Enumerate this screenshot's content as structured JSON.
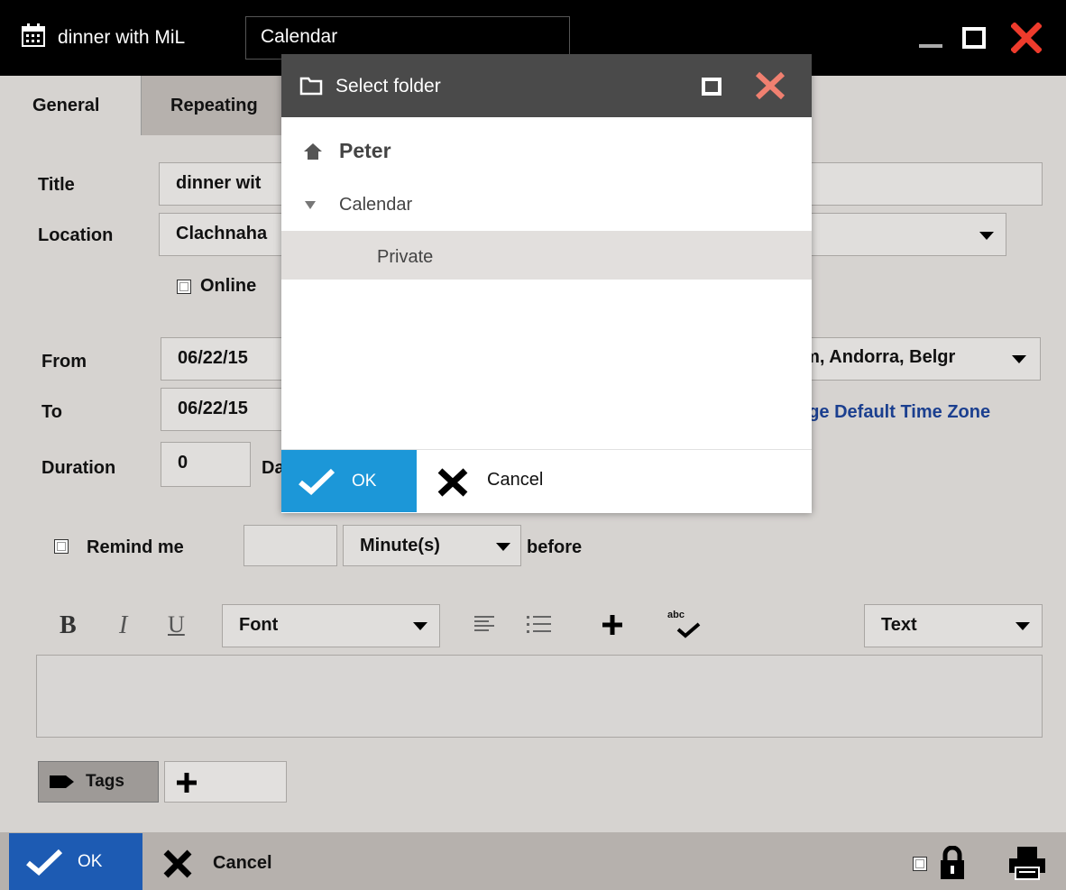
{
  "window": {
    "title": "dinner with MiL",
    "calendar_field": "Calendar"
  },
  "tabs": [
    {
      "label": "General"
    },
    {
      "label": "Repeating"
    }
  ],
  "form": {
    "title_label": "Title",
    "title_value": "dinner wit",
    "location_label": "Location",
    "location_value": "Clachnaha",
    "online_label": "Online",
    "from_label": "From",
    "from_date": "06/22/15",
    "timezone_value": "am, Andorra, Belgr",
    "to_label": "To",
    "to_date": "06/22/15",
    "change_timezone_link": "nge Default Time Zone",
    "duration_label": "Duration",
    "duration_value": "0",
    "duration_unit": "Da",
    "remind_label": "Remind me",
    "remind_unit": "Minute(s)",
    "before_label": "before"
  },
  "editor": {
    "bold": "B",
    "italic": "I",
    "underline": "U",
    "font_select": "Font",
    "format_select": "Text",
    "spellcheck_glyph": "abc"
  },
  "tags": {
    "label": "Tags"
  },
  "footer": {
    "ok_label": "OK",
    "cancel_label": "Cancel"
  },
  "dialog": {
    "title": "Select folder",
    "root": "Peter",
    "folder": "Calendar",
    "subfolder": "Private",
    "ok_label": "OK",
    "cancel_label": "Cancel"
  },
  "colors": {
    "accent_ok_dialog": "#1c97d8",
    "accent_ok_main": "#1d5bb3",
    "close_red": "#ee3b2c",
    "link_blue": "#1b3f8f"
  }
}
